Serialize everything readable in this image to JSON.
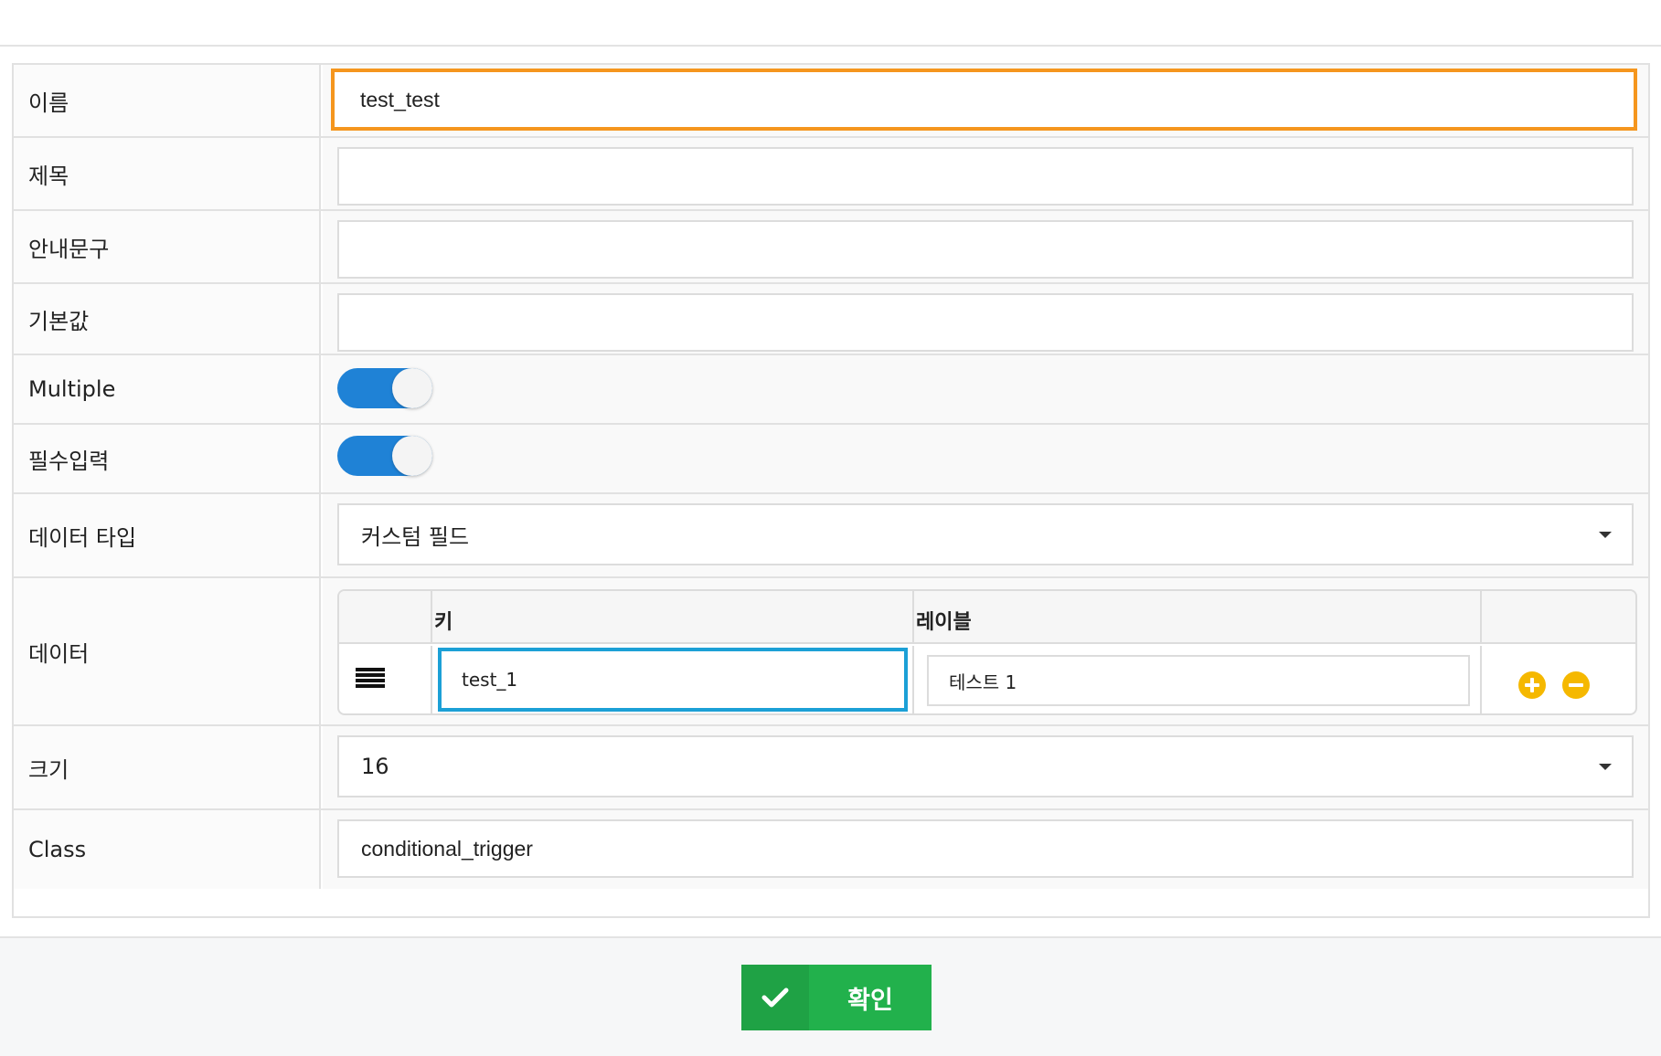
{
  "colors": {
    "focus_orange": "#f5961e",
    "focus_blue": "#1ca0d6",
    "toggle_on": "#1f82d6",
    "add_remove": "#f5b800",
    "confirm_green": "#22b14c"
  },
  "form": {
    "name": {
      "label": "이름",
      "value": "test_test"
    },
    "title": {
      "label": "제목",
      "value": ""
    },
    "guide_text": {
      "label": "안내문구",
      "value": ""
    },
    "default_value": {
      "label": "기본값",
      "value": ""
    },
    "multiple": {
      "label": "Multiple",
      "checked": true
    },
    "required": {
      "label": "필수입력",
      "checked": true
    },
    "data_type": {
      "label": "데이터 타입",
      "selected": "커스텀 필드"
    },
    "data": {
      "label": "데이터",
      "columns": {
        "key": "키",
        "label": "레이블"
      },
      "rows": [
        {
          "key": "test_1",
          "label": "테스트 1"
        }
      ],
      "icons": {
        "drag": "drag-handle-icon",
        "add": "plus-circle-icon",
        "remove": "minus-circle-icon"
      }
    },
    "size": {
      "label": "크기",
      "selected": "16"
    },
    "class": {
      "label": "Class",
      "value": "conditional_trigger"
    }
  },
  "footer": {
    "confirm_label": "확인",
    "confirm_icon": "check-icon"
  }
}
